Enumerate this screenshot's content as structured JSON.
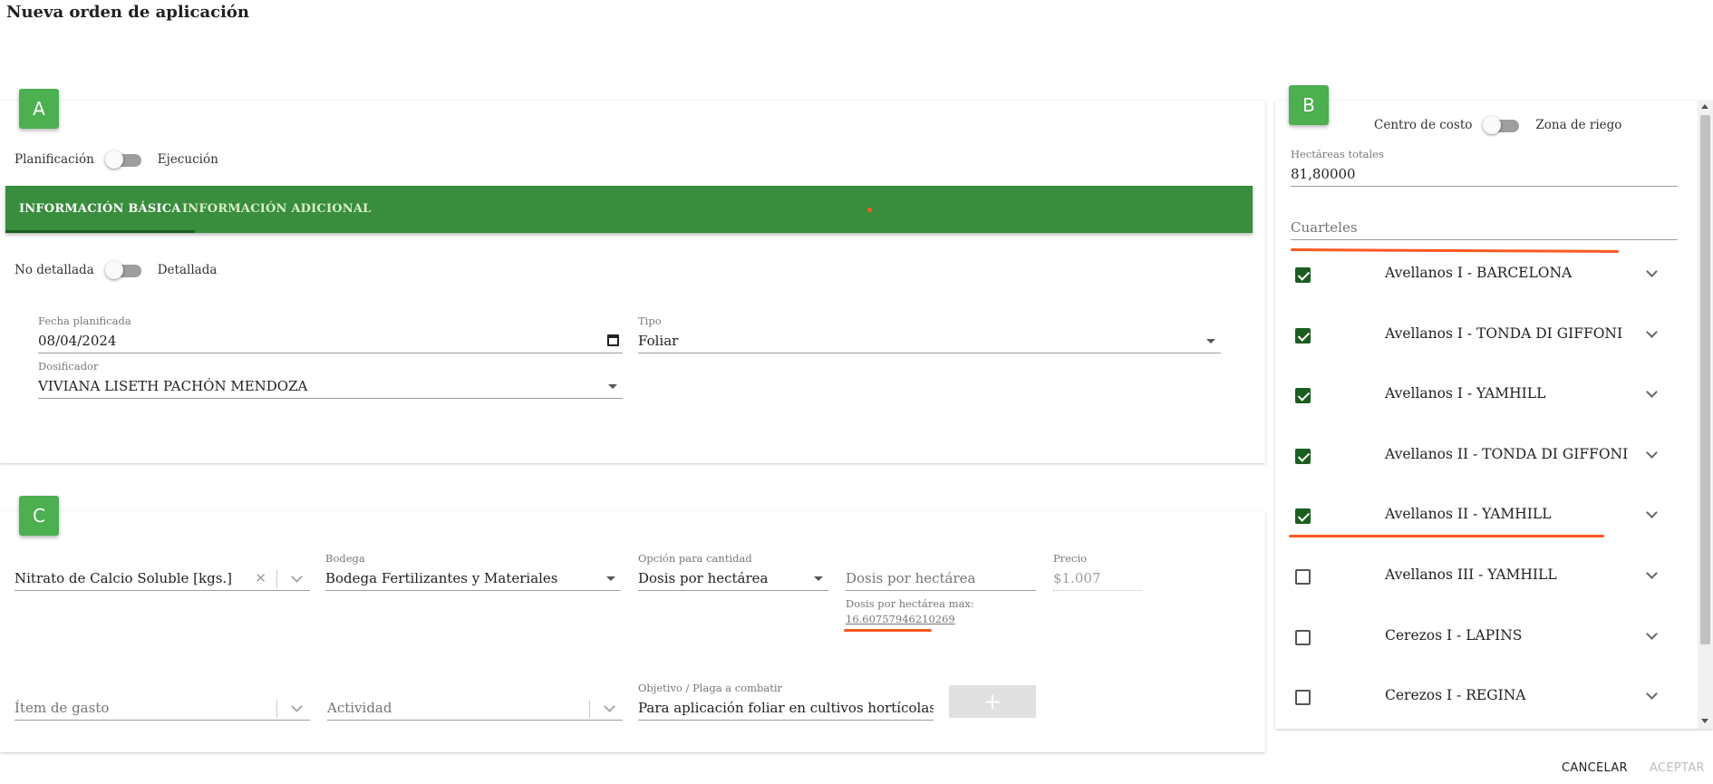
{
  "page": {
    "title": "Nueva orden de aplicación"
  },
  "colors": {
    "primary": "#388e3c",
    "badge": "#4caf50",
    "checkbox": "#1b5e20",
    "annotation": "#ff5722"
  },
  "section_a": {
    "badge": "A",
    "mode_toggle": {
      "left": "Planificación",
      "right": "Ejecución"
    },
    "tabs": [
      {
        "label": "INFORMACIÓN BÁSICA",
        "active": true
      },
      {
        "label": "INFORMACIÓN ADICIONAL",
        "active": false
      }
    ],
    "detail_toggle": {
      "left": "No detallada",
      "right": "Detallada"
    },
    "fecha": {
      "label": "Fecha planificada",
      "value": "08/04/2024",
      "icon": "calendar-icon"
    },
    "tipo": {
      "label": "Tipo",
      "value": "Foliar"
    },
    "dosificador": {
      "label": "Dosificador",
      "value": "VIVIANA LISETH PACHÓN MENDOZA"
    }
  },
  "section_b": {
    "badge": "B",
    "cost_toggle": {
      "left": "Centro de costo",
      "right": "Zona de riego"
    },
    "hectareas": {
      "label": "Hectáreas totales",
      "value": "81,80000"
    },
    "cuarteles_placeholder": "Cuarteles",
    "cuarteles": [
      {
        "name": "Avellanos I - BARCELONA",
        "checked": true
      },
      {
        "name": "Avellanos I - TONDA DI GIFFONI",
        "checked": true
      },
      {
        "name": "Avellanos I - YAMHILL",
        "checked": true
      },
      {
        "name": "Avellanos II - TONDA DI GIFFONI",
        "checked": true
      },
      {
        "name": "Avellanos II - YAMHILL",
        "checked": true
      },
      {
        "name": "Avellanos III - YAMHILL",
        "checked": false
      },
      {
        "name": "Cerezos I - LAPINS",
        "checked": false
      },
      {
        "name": "Cerezos I - REGINA",
        "checked": false
      }
    ]
  },
  "section_c": {
    "badge": "C",
    "producto": {
      "value": "Nitrato de Calcio Soluble [kgs.]",
      "clear": "✕"
    },
    "bodega": {
      "label": "Bodega",
      "value": "Bodega Fertilizantes y Materiales"
    },
    "opcion": {
      "label": "Opción para cantidad",
      "value": "Dosis por hectárea"
    },
    "dosis": {
      "placeholder": "Dosis por hectárea",
      "hint": "Dosis por hectárea max:",
      "max": "16.60757946210269"
    },
    "precio": {
      "label": "Precio",
      "value": "$1.007"
    },
    "item_gasto": {
      "placeholder": "Ítem de gasto"
    },
    "actividad": {
      "placeholder": "Actividad"
    },
    "objetivo": {
      "label": "Objetivo / Plaga a combatir",
      "value": "Para aplicación foliar en cultivos hortícolas y a"
    },
    "add_button": "+"
  },
  "footer": {
    "cancel": "CANCELAR",
    "accept": "ACEPTAR"
  }
}
